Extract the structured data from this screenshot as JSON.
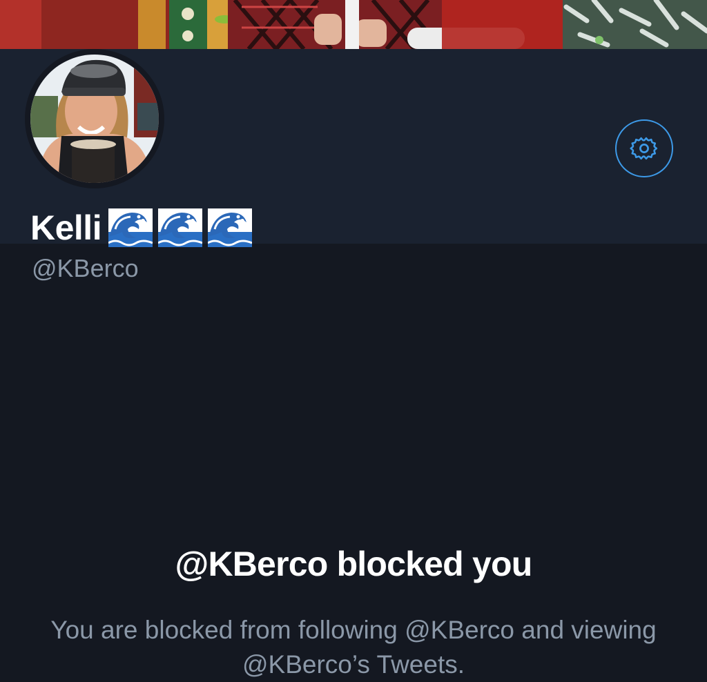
{
  "profile": {
    "display_name": "Kelli",
    "name_emojis": [
      "water-wave-icon",
      "water-wave-icon",
      "water-wave-icon"
    ],
    "handle": "@KBerco",
    "settings_icon": "gear-icon"
  },
  "blocked_notice": {
    "title": "@KBerco blocked you",
    "description": "You are blocked from following @KBerco and viewing @KBerco’s Tweets."
  },
  "colors": {
    "background": "#141821",
    "panel": "#1a2230",
    "accent": "#3d9ae8",
    "secondary_text": "#8b98a8",
    "primary_text": "#ffffff"
  }
}
